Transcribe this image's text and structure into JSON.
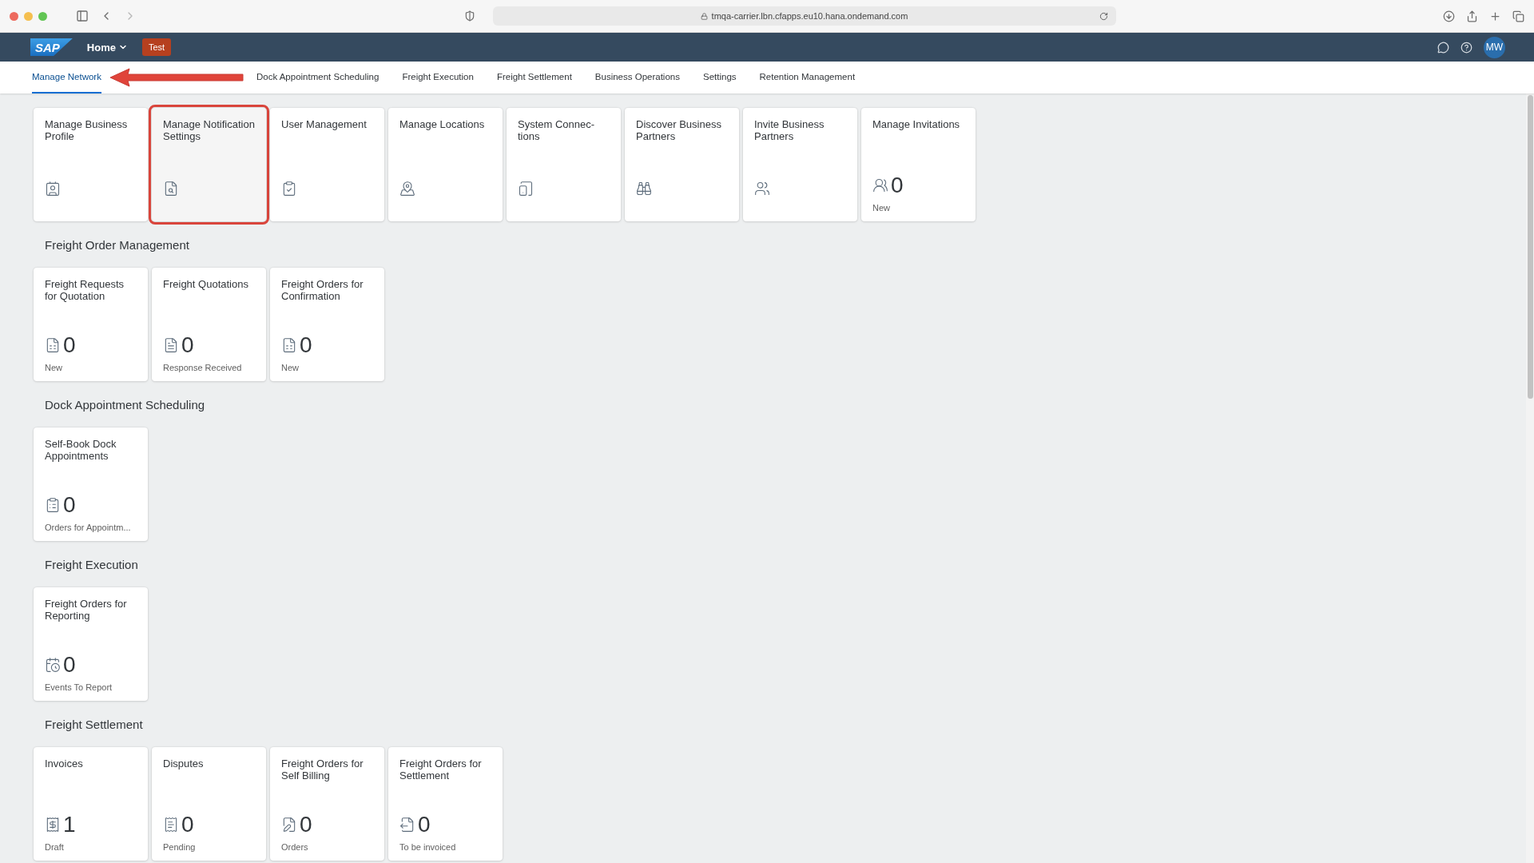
{
  "browser": {
    "url": "tmqa-carrier.lbn.cfapps.eu10.hana.ondemand.com"
  },
  "shell": {
    "logo": "SAP",
    "home": "Home",
    "system_badge": "Test",
    "avatar": "MW"
  },
  "tabs": [
    {
      "label": "Manage Network",
      "selected": true
    },
    {
      "label": "Dock Appointment Scheduling",
      "selected": false
    },
    {
      "label": "Freight Execution",
      "selected": false
    },
    {
      "label": "Freight Settlement",
      "selected": false
    },
    {
      "label": "Business Operations",
      "selected": false
    },
    {
      "label": "Settings",
      "selected": false
    },
    {
      "label": "Retention Management",
      "selected": false
    }
  ],
  "groups": [
    {
      "tiles": [
        {
          "title": "Manage Business Profile",
          "highlighted": false
        },
        {
          "title": "Manage Notification Settings",
          "highlighted": true
        },
        {
          "title": "User Management",
          "highlighted": false
        },
        {
          "title": "Manage Locations",
          "highlighted": false
        },
        {
          "title": "System Connec-tions",
          "highlighted": false
        },
        {
          "title": "Discover Business Partners",
          "highlighted": false
        },
        {
          "title": "Invite Business Partners",
          "highlighted": false
        },
        {
          "title": "Manage Invitations",
          "count": "0",
          "status": "New",
          "highlighted": false
        }
      ]
    },
    {
      "title": "Freight Order Management",
      "tiles": [
        {
          "title": "Freight Requests for Quotation",
          "count": "0",
          "status": "New",
          "highlighted": false
        },
        {
          "title": "Freight Quotations",
          "count": "0",
          "status": "Response Received",
          "highlighted": false
        },
        {
          "title": "Freight Orders for Confirmation",
          "count": "0",
          "status": "New",
          "highlighted": false
        }
      ]
    },
    {
      "title": "Dock Appointment Scheduling",
      "tiles": [
        {
          "title": "Self-Book Dock Appointments",
          "count": "0",
          "status": "Orders for Appointm...",
          "highlighted": false
        }
      ]
    },
    {
      "title": "Freight Execution",
      "tiles": [
        {
          "title": "Freight Orders for Reporting",
          "count": "0",
          "status": "Events To Report",
          "highlighted": false
        }
      ]
    },
    {
      "title": "Freight Settlement",
      "tiles": [
        {
          "title": "Invoices",
          "count": "1",
          "status": "Draft",
          "highlighted": false
        },
        {
          "title": "Disputes",
          "count": "0",
          "status": "Pending",
          "highlighted": false
        },
        {
          "title": "Freight Orders for Self Billing",
          "count": "0",
          "status": "Orders",
          "highlighted": false
        },
        {
          "title": "Freight Orders for Settlement",
          "count": "0",
          "status": "To be invoiced",
          "highlighted": false
        }
      ]
    }
  ]
}
